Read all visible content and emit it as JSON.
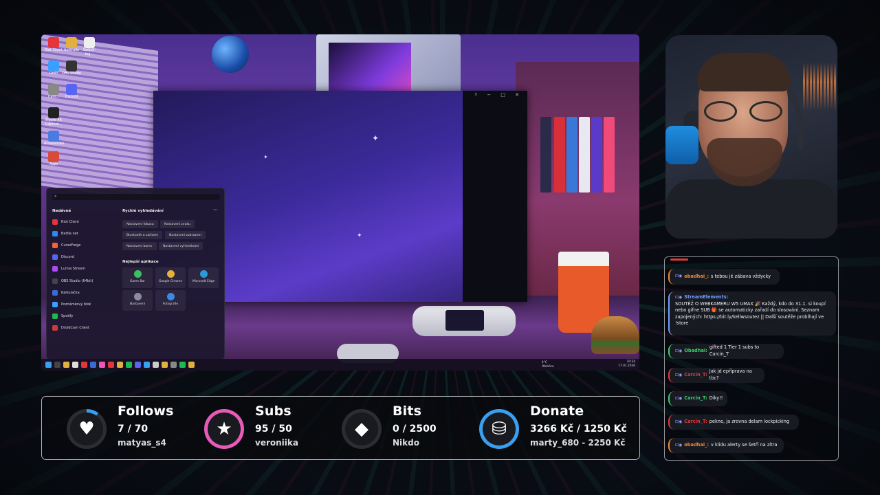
{
  "desktop": {
    "icons": [
      {
        "label": "Riot Client",
        "color": "#e4353a"
      },
      {
        "label": "Australie",
        "color": "#e0b040"
      },
      {
        "label": "Switch-log...",
        "color": "#eeeeee"
      },
      {
        "label": "UniFi",
        "color": "#3aa0ff"
      },
      {
        "label": "OBS Studio",
        "color": "#333333"
      },
      {
        "label": "Cam...",
        "color": "#888888"
      },
      {
        "label": "Discord",
        "color": "#5865f2"
      },
      {
        "label": "Elgato 4K Capture...",
        "color": "#222222"
      },
      {
        "label": "Accessories",
        "color": "#4a7be0"
      },
      {
        "label": "Apps",
        "color": "#d84a3a"
      }
    ],
    "window_controls": "?  −  □  ✕",
    "start_menu": {
      "pinned_title": "Nedávné",
      "pinned": [
        {
          "label": "Riot Client",
          "color": "#e4353a"
        },
        {
          "label": "Battle.net",
          "color": "#2a8cf0"
        },
        {
          "label": "CurseForge",
          "color": "#f16436"
        },
        {
          "label": "Discord",
          "color": "#5865f2"
        },
        {
          "label": "Lumia Stream",
          "color": "#b04af0"
        },
        {
          "label": "OBS Studio (64bit)",
          "color": "#444444"
        },
        {
          "label": "Kalkulačka",
          "color": "#3a6ad8"
        },
        {
          "label": "Poznámkový blok",
          "color": "#3aa0ff"
        },
        {
          "label": "Spotify",
          "color": "#1db954"
        },
        {
          "label": "DroidCam Client",
          "color": "#cc3a3a"
        }
      ],
      "quick_title": "Rychlé vyhledávání",
      "quick_more": "···",
      "quick": [
        "Nastavení fokusu",
        "Nastavení zvuku",
        "Bluetooth a zařízení",
        "Nastavení zobrazení",
        "Nastavení barev",
        "Nastavení vyhledávání"
      ],
      "apps_title": "Nejlepší aplikace",
      "apps": [
        {
          "label": "Game Bar",
          "color": "#3ac060"
        },
        {
          "label": "Google Chrome",
          "color": "#e8b23a"
        },
        {
          "label": "Microsoft Edge",
          "color": "#2a9ad8"
        },
        {
          "label": "Nastavení",
          "color": "#8a8aa0"
        },
        {
          "label": "Fotografie",
          "color": "#3a8ae8"
        }
      ]
    },
    "taskbar": {
      "weather_temp": "4°C",
      "weather_desc": "Oblačno",
      "time": "10:34",
      "date": "17.01.2026"
    }
  },
  "chat": [
    {
      "user": "obadhai_:",
      "text": "s tebou jé zábava vždycky",
      "user_color": "#f08a3a",
      "border": "#f08a3a"
    },
    {
      "user": "StreamElements:",
      "text": "SOUTĚŽ O WEBKAMERU W5 UMAX 🎉 Každý, kdo do 31.1. si koupí nebo gifne SUB 🎁 se automaticky zařadí do slosování. Seznam zapojených: https://bit.ly/kellwsoutez || Další soutěže probíhají ve !store",
      "user_color": "#6fa0ff",
      "border": "#6fa0ff"
    },
    {
      "user": "Obadhai:",
      "text": "gifted 1 Tier 1 subs to Carcin_T",
      "user_color": "#3ad06a",
      "border": "#3ad06a"
    },
    {
      "user": "Carcin_T:",
      "text": "Jak jd epříprava na tbc?",
      "user_color": "#e33a3a",
      "border": "#e33a3a"
    },
    {
      "user": "Carcin_T:",
      "text": "Díky!!",
      "user_color": "#3ad06a",
      "border": "#3ad06a"
    },
    {
      "user": "Carcin_T:",
      "text": "pekne, ja zrovna delam lockpicking",
      "user_color": "#e33a3a",
      "border": "#e33a3a"
    },
    {
      "user": "obadhai_:",
      "text": "v klidu alerty se šetří na zítra",
      "user_color": "#f08a3a",
      "border": "#f08a3a"
    }
  ],
  "goals": [
    {
      "title": "Follows",
      "value": "7 / 70",
      "user": "matyas_s4",
      "icon": "heart-icon",
      "glyph": "♥",
      "accent": "#3a9ff0",
      "progress": 0.1
    },
    {
      "title": "Subs",
      "value": "95 / 50",
      "user": "veroniika",
      "icon": "star-icon",
      "glyph": "★",
      "accent": "#e85ab8",
      "progress": 1.0
    },
    {
      "title": "Bits",
      "value": "0 / 2500",
      "user": "Nikdo",
      "icon": "bits-gem-icon",
      "glyph": "◆",
      "accent": "#2a2a30",
      "progress": 0.0
    },
    {
      "title": "Donate",
      "value": "3266 Kč / 1250 Kč",
      "user": "marty_680 - 2250 Kč",
      "icon": "coins-icon",
      "glyph": "⛁",
      "accent": "#3a9ff0",
      "progress": 1.0
    }
  ]
}
